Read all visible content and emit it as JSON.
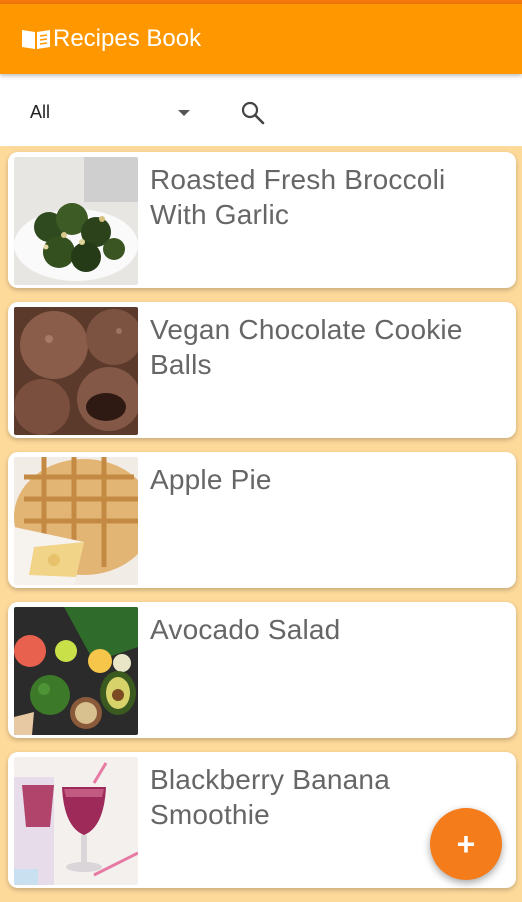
{
  "app": {
    "title": "Recipes Book"
  },
  "filter": {
    "category": "All"
  },
  "recipes": [
    {
      "name": "Roasted Fresh Broccoli With Garlic",
      "image": "broccoli-photo"
    },
    {
      "name": "Vegan Chocolate Cookie Balls",
      "image": "cookie-balls-photo"
    },
    {
      "name": "Apple Pie",
      "image": "apple-pie-photo"
    },
    {
      "name": "Avocado Salad",
      "image": "avocado-salad-photo"
    },
    {
      "name": "Blackberry Banana Smoothie",
      "image": "smoothie-photo"
    }
  ],
  "fab": {
    "label": "+"
  },
  "colors": {
    "appbar": "#ff9800",
    "background": "#fdd99a",
    "fab": "#f57c1b"
  }
}
